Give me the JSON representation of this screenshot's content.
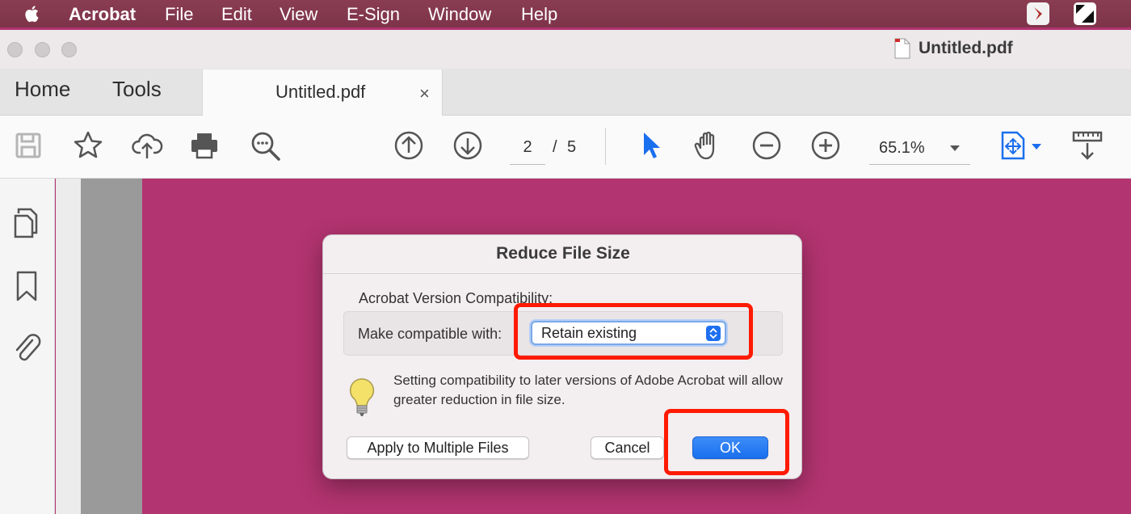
{
  "menubar": {
    "app": "Acrobat",
    "items": [
      "File",
      "Edit",
      "View",
      "E-Sign",
      "Window",
      "Help"
    ]
  },
  "window": {
    "title": "Untitled.pdf"
  },
  "tabs": {
    "home": "Home",
    "tools": "Tools",
    "document": "Untitled.pdf",
    "close": "×"
  },
  "toolbar": {
    "current_page": "2",
    "page_separator": "/",
    "total_pages": "5",
    "zoom": "65.1%"
  },
  "dialog": {
    "title": "Reduce File Size",
    "section_label": "Acrobat Version Compatibility:",
    "compat_label": "Make compatible with:",
    "compat_value": "Retain existing",
    "info": "Setting compatibility to later versions of Adobe Acrobat will allow greater reduction in file size.",
    "apply_button": "Apply to Multiple Files",
    "cancel_button": "Cancel",
    "ok_button": "OK"
  },
  "colors": {
    "canvas": "#b23470",
    "highlight": "#ff1a00",
    "accent": "#1a6fee"
  }
}
